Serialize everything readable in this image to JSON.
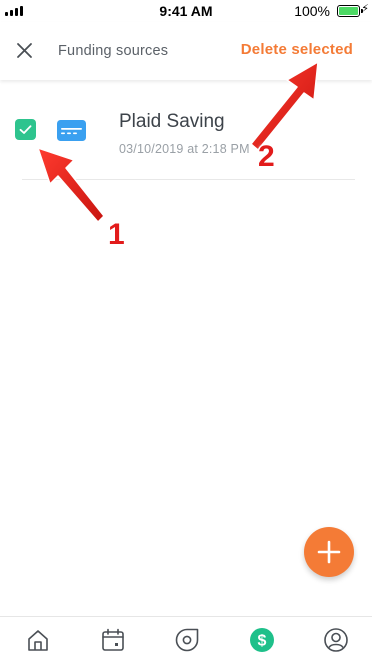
{
  "status_bar": {
    "time": "9:41 AM",
    "battery": "100%",
    "battery_color": "#4cd964"
  },
  "header": {
    "close_icon": "close-icon",
    "title": "Funding sources",
    "delete_label": "Delete selected"
  },
  "items": [
    {
      "checked": true,
      "icon": "credit-card-icon",
      "name": "Plaid Saving",
      "date": "03/10/2019 at 2:18 PM"
    }
  ],
  "annotations": [
    {
      "label": "1"
    },
    {
      "label": "2"
    }
  ],
  "fab": {
    "icon": "plus-icon"
  },
  "bottom_nav": [
    {
      "icon": "home-icon"
    },
    {
      "icon": "calendar-icon"
    },
    {
      "icon": "explore-icon"
    },
    {
      "icon": "dollar-icon",
      "active": true
    },
    {
      "icon": "profile-icon"
    }
  ],
  "colors": {
    "accent": "#f47b36",
    "checkbox": "#2ec48e",
    "card_icon": "#3aa0f0",
    "active_nav": "#1ec08a",
    "annotation": "#e21b1b"
  }
}
